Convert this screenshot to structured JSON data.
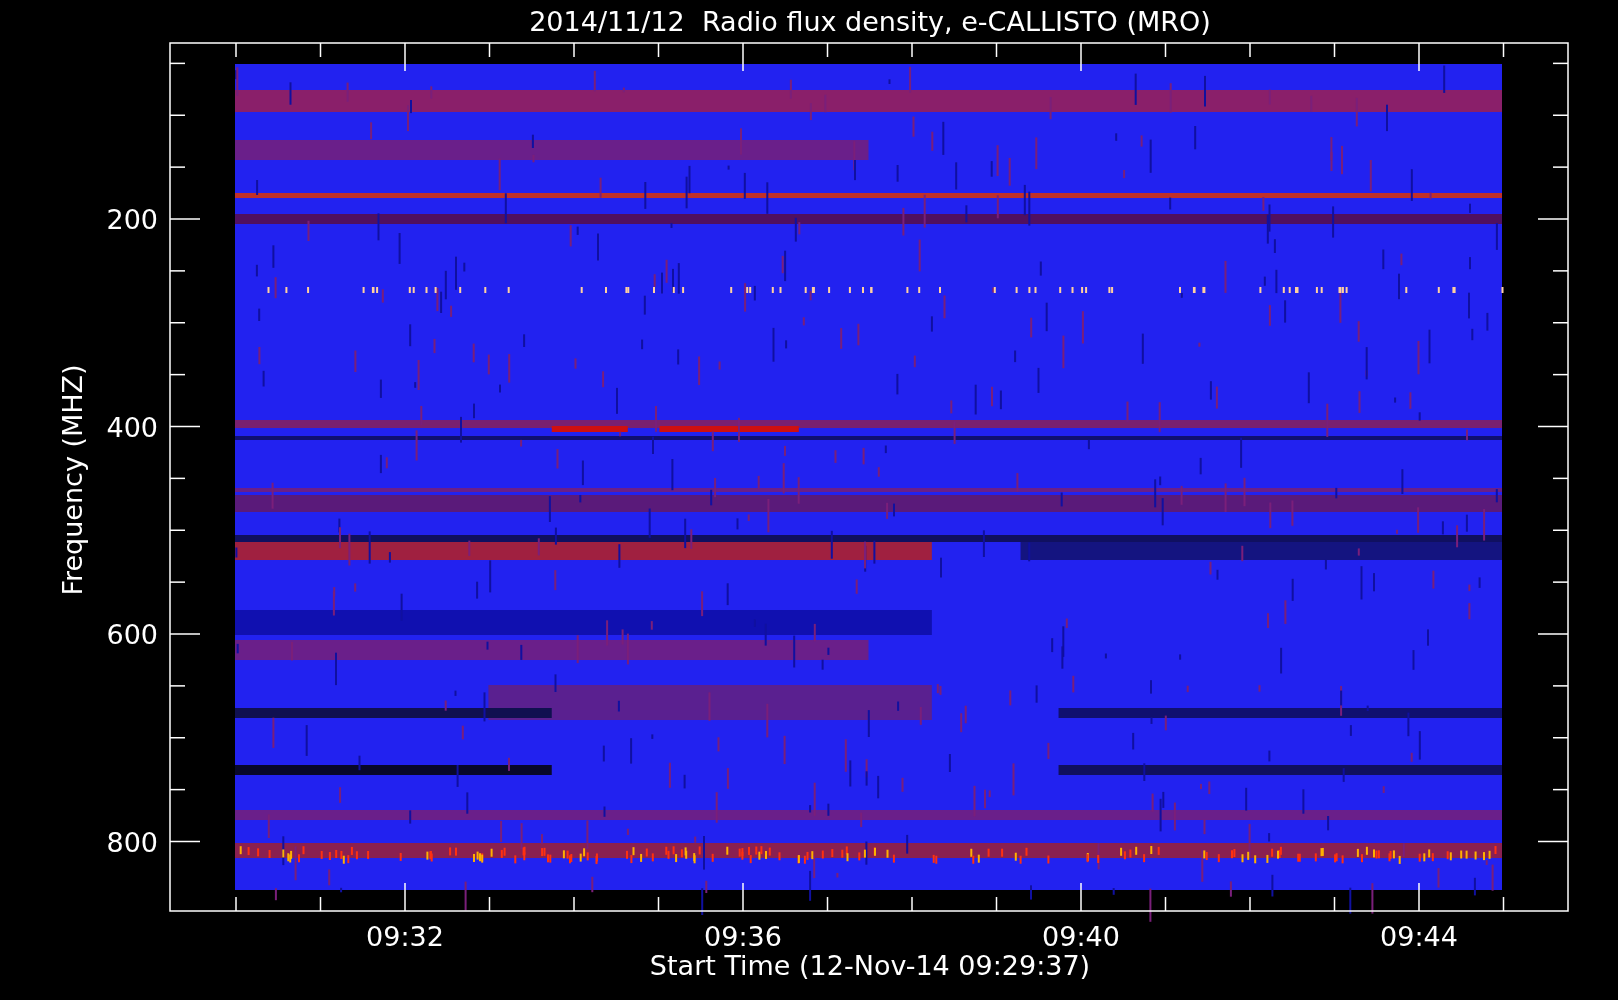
{
  "title": "2014/11/12  Radio flux density, e-CALLISTO (MRO)",
  "y_axis": {
    "label": "Frequency (MHZ)",
    "ticks": [
      "200",
      "400",
      "600",
      "800"
    ]
  },
  "x_axis": {
    "label": "Start Time (12-Nov-14 09:29:37)",
    "ticks": [
      "09:32",
      "09:36",
      "09:40",
      "09:44"
    ]
  }
}
